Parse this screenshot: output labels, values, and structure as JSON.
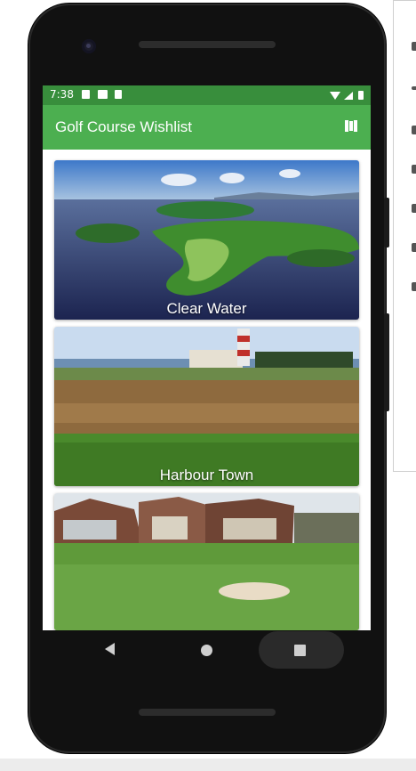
{
  "status_bar": {
    "time": "7:38"
  },
  "app_bar": {
    "title": "Golf Course Wishlist"
  },
  "courses": [
    {
      "name": "Clear Water"
    },
    {
      "name": "Harbour Town"
    },
    {
      "name": ""
    }
  ],
  "colors": {
    "status_bar": "#388e3c",
    "app_bar": "#4caf50"
  },
  "icons": {
    "action": "map-icon",
    "nav": [
      "back-icon",
      "home-icon",
      "recents-icon"
    ]
  }
}
